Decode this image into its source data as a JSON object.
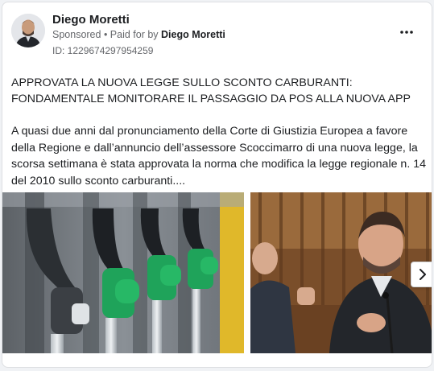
{
  "post": {
    "author": "Diego Moretti",
    "sponsored_label": "Sponsored",
    "separator": " • ",
    "paid_for_prefix": "Paid for by ",
    "paid_for_name": "Diego Moretti",
    "ad_id": "ID: 1229674297954259",
    "headline": "APPROVATA LA NUOVA LEGGE SULLO SCONTO CARBURANTI: FONDAMENTALE MONITORARE IL PASSAGGIO DA POS ALLA NUOVA APP",
    "body": "A quasi due anni dal pronunciamento della Corte di Giustizia Europea a favore della Regione e dall’annuncio dell’assessore Scoccimarro di una nuova legge, la scorsa settimana è stata approvata la norma che modifica la legge regionale n. 14 del 2010 sullo sconto carburanti...."
  },
  "icons": {
    "more": "more-options-icon",
    "next": "chevron-right-icon"
  },
  "colors": {
    "nozzle_green": "#1fa35a",
    "text_primary": "#1c1e21",
    "text_secondary": "#65676b"
  }
}
